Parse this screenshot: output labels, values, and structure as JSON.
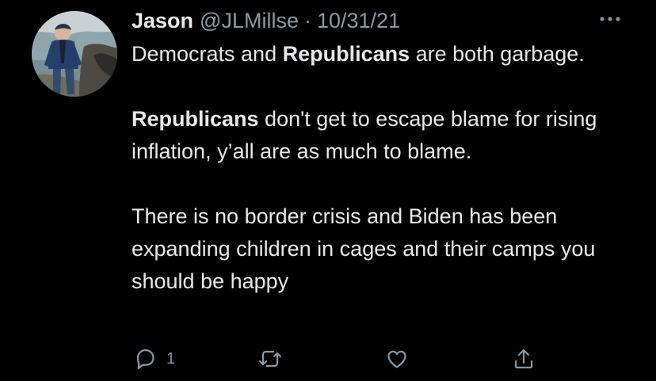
{
  "tweet": {
    "author": {
      "display_name": "Jason",
      "handle": "@JLMillse",
      "separator": "·",
      "date": "10/31/21"
    },
    "more_icon": "more-horizontal-icon",
    "paragraphs": [
      {
        "before": "Democrats and ",
        "bold": "Republicans",
        "after": " are both garbage."
      },
      {
        "before": "",
        "bold": "Republicans",
        "after": " don't get to escape blame for rising inflation, y’all are as much to blame."
      },
      {
        "text": "There is no border crisis and Biden has been expanding children in cages and their camps you should be happy"
      }
    ],
    "actions": {
      "reply_count": "1",
      "icons": [
        "reply-icon",
        "retweet-icon",
        "like-icon",
        "share-icon"
      ]
    }
  },
  "colors": {
    "background": "#000000",
    "primary_text": "#e7e9ea",
    "secondary_text": "#8b98a5"
  }
}
